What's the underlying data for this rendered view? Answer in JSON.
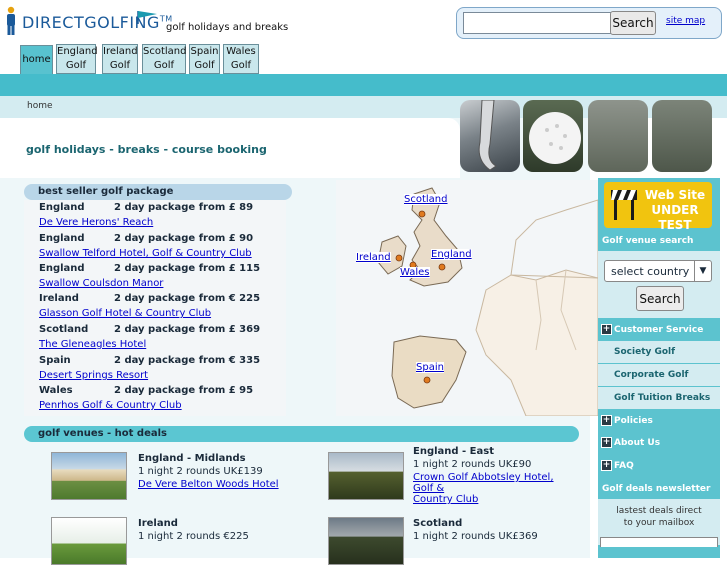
{
  "header": {
    "logo_direct": "DIRECT",
    "logo_golfing": "GOLFING",
    "logo_tm": "TM",
    "tagline": "golf holidays and breaks",
    "search_button": "Search",
    "sitemap_link": "site map"
  },
  "tabs": [
    {
      "line1": "home",
      "line2": ""
    },
    {
      "line1": "England",
      "line2": "Golf"
    },
    {
      "line1": "Ireland",
      "line2": "Golf"
    },
    {
      "line1": "Scotland",
      "line2": "Golf"
    },
    {
      "line1": "Spain",
      "line2": "Golf"
    },
    {
      "line1": "Wales",
      "line2": "Golf"
    }
  ],
  "breadcrumb": "home",
  "page_title": "golf holidays - breaks - course booking",
  "best_seller": {
    "heading": "best seller golf package",
    "items": [
      {
        "country": "England",
        "deal": "2 day package from £ 89",
        "venue": "De Vere Herons' Reach"
      },
      {
        "country": "England",
        "deal": "2 day package from £ 90",
        "venue": "Swallow Telford Hotel, Golf & Country Club"
      },
      {
        "country": "England",
        "deal": "2 day package from £ 115",
        "venue": "Swallow Coulsdon Manor"
      },
      {
        "country": "Ireland",
        "deal": "2 day package from € 225",
        "venue": "Glasson Golf Hotel & Country Club"
      },
      {
        "country": "Scotland",
        "deal": "2 day package from £ 369",
        "venue": "The Gleneagles Hotel"
      },
      {
        "country": "Spain",
        "deal": "2 day package from € 335",
        "venue": "Desert Springs Resort"
      },
      {
        "country": "Wales",
        "deal": "2 day package from £ 95",
        "venue": "Penrhos Golf & Country Club"
      }
    ]
  },
  "map": {
    "labels": {
      "scotland": "Scotland",
      "ireland": "Ireland",
      "england": "England",
      "wales": "Wales",
      "spain": "Spain"
    }
  },
  "hot_deals": {
    "heading": "golf venues - hot deals",
    "cards": [
      {
        "title": "England - Midlands",
        "line": "1 night 2 rounds UK£139",
        "link": "De Vere Belton Woods Hotel",
        "link2": ""
      },
      {
        "title": "England - East",
        "line": "1 night 2 rounds UK£90",
        "link": "Crown Golf Abbotsley Hotel, Golf &",
        "link2": "Country Club"
      },
      {
        "title": "Ireland",
        "line": "1 night 2 rounds €225",
        "link": "",
        "link2": ""
      },
      {
        "title": "Scotland",
        "line": "1 night 2 rounds UK£369",
        "link": "",
        "link2": ""
      }
    ]
  },
  "sidebar": {
    "banner_line1": "Web Site",
    "banner_line2": "UNDER TEST",
    "venue_search_label": "Golf venue search",
    "select_value": "select country",
    "search_button": "Search",
    "menu": [
      {
        "label": "Customer Service",
        "expandable": true
      },
      {
        "label": "Society Golf",
        "expandable": false
      },
      {
        "label": "Corporate Golf",
        "expandable": false
      },
      {
        "label": "Golf Tuition Breaks",
        "expandable": false
      },
      {
        "label": "Policies",
        "expandable": true
      },
      {
        "label": "About Us",
        "expandable": true
      },
      {
        "label": "FAQ",
        "expandable": true
      }
    ],
    "newsletter_label": "Golf deals newsletter",
    "newsletter_line1": "lastest deals direct",
    "newsletter_line2": "to your mailbox"
  },
  "colors": {
    "teal": "#45bccb",
    "pale_teal": "#d4ecf1",
    "link": "#0000cc",
    "banner_yellow": "#f1c40f"
  }
}
